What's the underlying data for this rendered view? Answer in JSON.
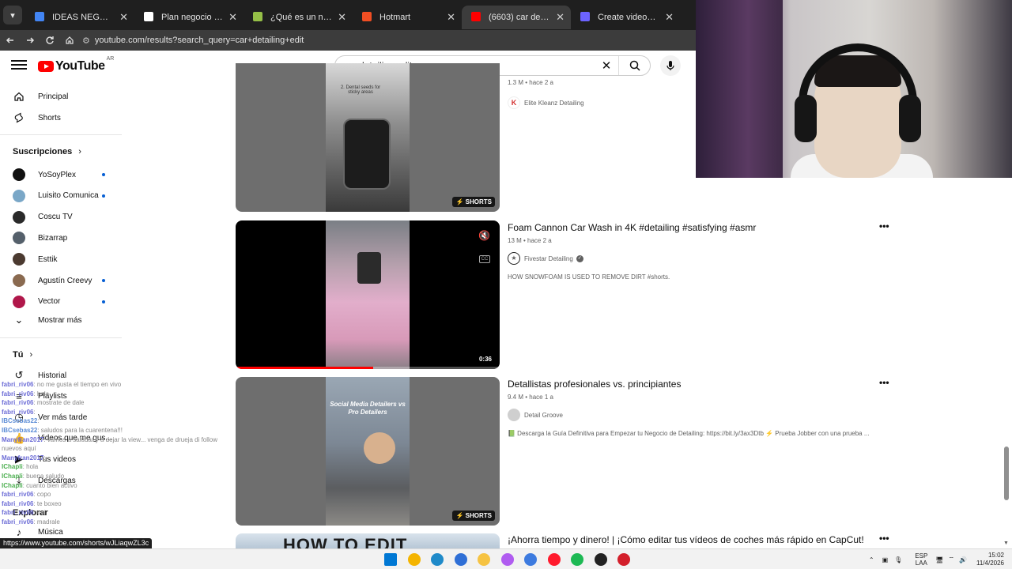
{
  "browser": {
    "tabs": [
      {
        "label": "IDEAS NEGOCIO - Docum",
        "favicon_color": "#4285f4",
        "active": false
      },
      {
        "label": "Plan negocio cursos venta",
        "favicon_color": "#ffffff",
        "active": false
      },
      {
        "label": "¿Qué es un nicho de mer",
        "favicon_color": "#95bf47",
        "active": false
      },
      {
        "label": "Hotmart",
        "favicon_color": "#f04e23",
        "active": false
      },
      {
        "label": "(6603) car detailing edit -",
        "favicon_color": "#ff0000",
        "active": true
      },
      {
        "label": "Create videos from link o",
        "favicon_color": "#6c63ff",
        "active": false
      }
    ],
    "url": "youtube.com/results?search_query=car+detailing+edit"
  },
  "youtube": {
    "logo_text": "YouTube",
    "country_code": "AR",
    "search_value": "car detailing edit"
  },
  "sidebar": {
    "main": [
      {
        "label": "Principal",
        "icon": "home-icon"
      },
      {
        "label": "Shorts",
        "icon": "shorts-icon"
      }
    ],
    "subscriptions_title": "Suscripciones",
    "subscriptions": [
      {
        "label": "YoSoyPlex",
        "new": true,
        "color": "#111111"
      },
      {
        "label": "Luisito Comunica",
        "new": true,
        "color": "#7aa7c7"
      },
      {
        "label": "Coscu TV",
        "new": false,
        "color": "#2a2a2a"
      },
      {
        "label": "Bizarrap",
        "new": false,
        "color": "#55606b"
      },
      {
        "label": "Esttik",
        "new": false,
        "color": "#4b3a30"
      },
      {
        "label": "Agustín Creevy",
        "new": true,
        "color": "#8a6a50"
      },
      {
        "label": "Vector",
        "new": true,
        "color": "#b0174a"
      }
    ],
    "show_more": "Mostrar más",
    "you_title": "Tú",
    "you_items": [
      {
        "label": "Historial",
        "icon": "history-icon"
      },
      {
        "label": "Playlists",
        "icon": "playlist-icon"
      },
      {
        "label": "Ver más tarde",
        "icon": "watch-later-icon"
      },
      {
        "label": "Videos que me gus...",
        "icon": "like-icon"
      },
      {
        "label": "Tus videos",
        "icon": "your-videos-icon"
      },
      {
        "label": "Descargas",
        "icon": "download-icon"
      }
    ],
    "explore_title": "Explorar",
    "explore_items": [
      {
        "label": "Música",
        "icon": "music-icon"
      }
    ]
  },
  "results": [
    {
      "title": "",
      "meta": "1.3 M • hace 2 a",
      "channel": "Elite Kleanz Detailing",
      "verified": false,
      "description": "",
      "badge": "SHORTS",
      "thumb_text": "2. Dental seeds for sticky areas"
    },
    {
      "title": "Foam Cannon Car Wash in 4K #detailing #satisfying #asmr",
      "meta": "13 M • hace 2 a",
      "channel": "Fivestar Detailing",
      "verified": true,
      "description": "HOW SNOWFOAM IS USED TO REMOVE DIRT #shorts.",
      "badge": "0:36",
      "progress": 0.52
    },
    {
      "title": "Detallistas profesionales vs. principiantes",
      "meta": "9.4 M • hace 1 a",
      "channel": "Detail Groove",
      "verified": false,
      "description": "📗 Descarga la Guía Definitiva para Empezar tu Negocio de Detailing: https://bit.ly/3ax3Dtb ⚡ Prueba Jobber con una prueba ...",
      "badge": "SHORTS",
      "thumb_text": "Social Media Detailers vs Pro Detailers"
    },
    {
      "title": "¡Ahorra tiempo y dinero! | ¡Cómo editar tus vídeos de coches más rápido en CapCut!",
      "meta": "",
      "channel": "",
      "verified": false,
      "description": "",
      "badge": "",
      "thumb_text": "HOW TO EDIT"
    }
  ],
  "chat": [
    {
      "user": "fabri_riv06",
      "msg": ": no me gusta el tiempo en vivo",
      "color": "purple"
    },
    {
      "user": "fabri_riv06",
      "msg": ": hola",
      "color": "purple"
    },
    {
      "user": "fabri_riv06",
      "msg": ": mostrate de dale",
      "color": "purple"
    },
    {
      "user": "fabri_riv06",
      "msg": ": ",
      "color": "purple"
    },
    {
      "user": "IBCsebas22",
      "msg": ": ",
      "color": "blue"
    },
    {
      "user": "IBCsebas22",
      "msg": ": saludos para la cuarentena!!!",
      "color": "blue"
    },
    {
      "user": "Manyfran2017",
      "msg": ": vamos a saludar y a dejar la view... venga de drueja di follow",
      "color": "purple"
    },
    {
      "user": "",
      "msg": "nuevos aquí",
      "color": "purple"
    },
    {
      "user": "Manyfran2017",
      "msg": ": ",
      "color": "purple"
    },
    {
      "user": "IChapli",
      "msg": ": hola",
      "color": "green"
    },
    {
      "user": "IChapli",
      "msg": ": buena saludo",
      "color": "green"
    },
    {
      "user": "IChapli",
      "msg": ": cuanto bien activo",
      "color": "green"
    },
    {
      "user": "fabri_riv06",
      "msg": ": copo",
      "color": "purple"
    },
    {
      "user": "fabri_riv06",
      "msg": ": te boxeo",
      "color": "purple"
    },
    {
      "user": "fabri_riv06",
      "msg": ": uni",
      "color": "purple"
    },
    {
      "user": "fabri_riv06",
      "msg": ": madrale",
      "color": "purple"
    }
  ],
  "hover_url": "https://www.youtube.com/shorts/wJLiaqwZL3c",
  "taskbar": {
    "lang_top": "ESP",
    "lang_bottom": "LAA",
    "time": "15:02",
    "date": "11/4/2026",
    "apps": [
      {
        "name": "windows-start-icon",
        "color": "#0078d4"
      },
      {
        "name": "chrome-icon",
        "color": "#f4b400"
      },
      {
        "name": "edge-icon",
        "color": "#1f8ac9"
      },
      {
        "name": "store-icon",
        "color": "#2f6fd6"
      },
      {
        "name": "explorer-icon",
        "color": "#f6c342"
      },
      {
        "name": "messenger-icon",
        "color": "#b05cf0"
      },
      {
        "name": "app-icon",
        "color": "#3d7bdf"
      },
      {
        "name": "opera-icon",
        "color": "#ff1b2d"
      },
      {
        "name": "spotify-icon",
        "color": "#1db954"
      },
      {
        "name": "record-icon",
        "color": "#222222"
      },
      {
        "name": "app2-icon",
        "color": "#d31f2b"
      }
    ]
  }
}
